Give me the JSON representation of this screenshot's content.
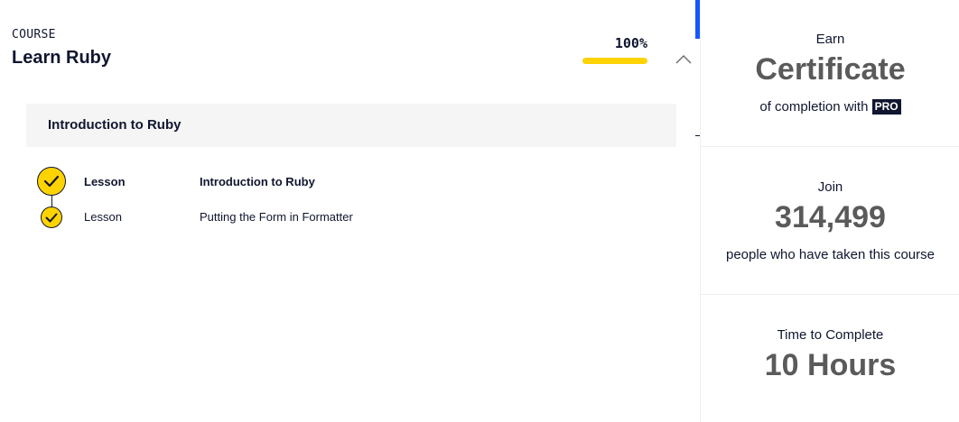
{
  "course": {
    "eyebrow": "COURSE",
    "title": "Learn Ruby",
    "progress_label": "100%",
    "progress_fraction": 1.0,
    "progress_color": "#ffd300"
  },
  "module": {
    "title": "Introduction to Ruby",
    "lessons": [
      {
        "type": "Lesson",
        "name": "Introduction to Ruby",
        "completed": true,
        "icon": "check-circle-icon"
      },
      {
        "type": "Lesson",
        "name": "Putting the Form in Formatter",
        "completed": true,
        "icon": "check-circle-icon"
      }
    ]
  },
  "sidebar": {
    "certificate": {
      "pre": "Earn",
      "big": "Certificate",
      "post": "of completion with",
      "badge": "PRO"
    },
    "learners": {
      "pre": "Join",
      "big": "314,499",
      "post": "people who have taken this course"
    },
    "time": {
      "pre": "Time to Complete",
      "big": "10 Hours"
    }
  },
  "icons": {
    "collapse": "chevron-up-icon"
  },
  "colors": {
    "accent_yellow": "#ffd300",
    "ink": "#10162f",
    "scroll_accent": "#1557ff"
  }
}
